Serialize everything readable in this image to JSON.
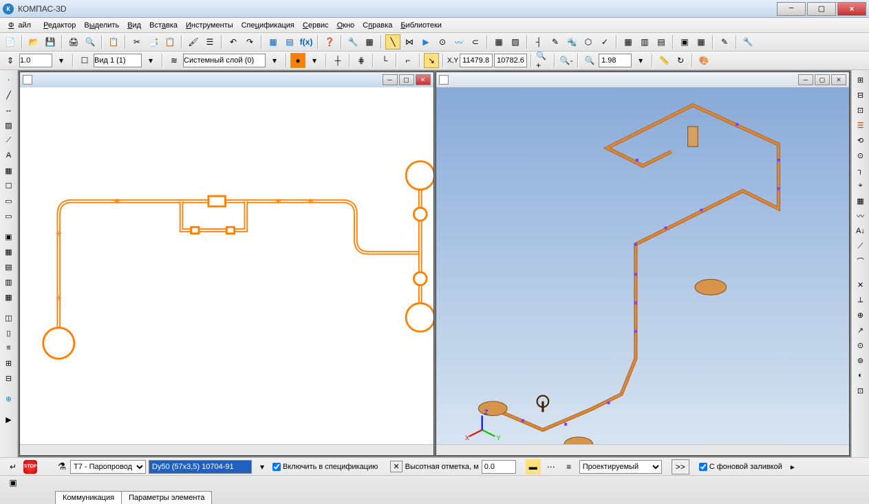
{
  "app": {
    "title": "КОМПАС-3D"
  },
  "menu": {
    "file": "Файл",
    "edit": "Редактор",
    "select": "Выделить",
    "view": "Вид",
    "insert": "Вставка",
    "tools": "Инструменты",
    "spec": "Спецификация",
    "service": "Сервис",
    "window": "Окно",
    "help": "Справка",
    "libs": "Библиотеки"
  },
  "tb2": {
    "scale": "1.0",
    "view": "Вид 1 (1)",
    "layer": "Системный слой (0)",
    "coordX": "11479.8",
    "coordY": "10782.6",
    "zoom": "1.98"
  },
  "props": {
    "pipeType": "Т7 - Паропровод",
    "pipeSize": "Dy50 (57x3,5) 10704-91",
    "includeInSpec": "Включить в спецификацию",
    "elevationLabel": "Высотная отметка, м",
    "elevation": "0.0",
    "status": "Проектируемый",
    "bgFill": "С фоновой заливкой",
    "moreBtn": ">>"
  },
  "tabs": {
    "comm": "Коммуникация",
    "params": "Параметры элемента"
  }
}
